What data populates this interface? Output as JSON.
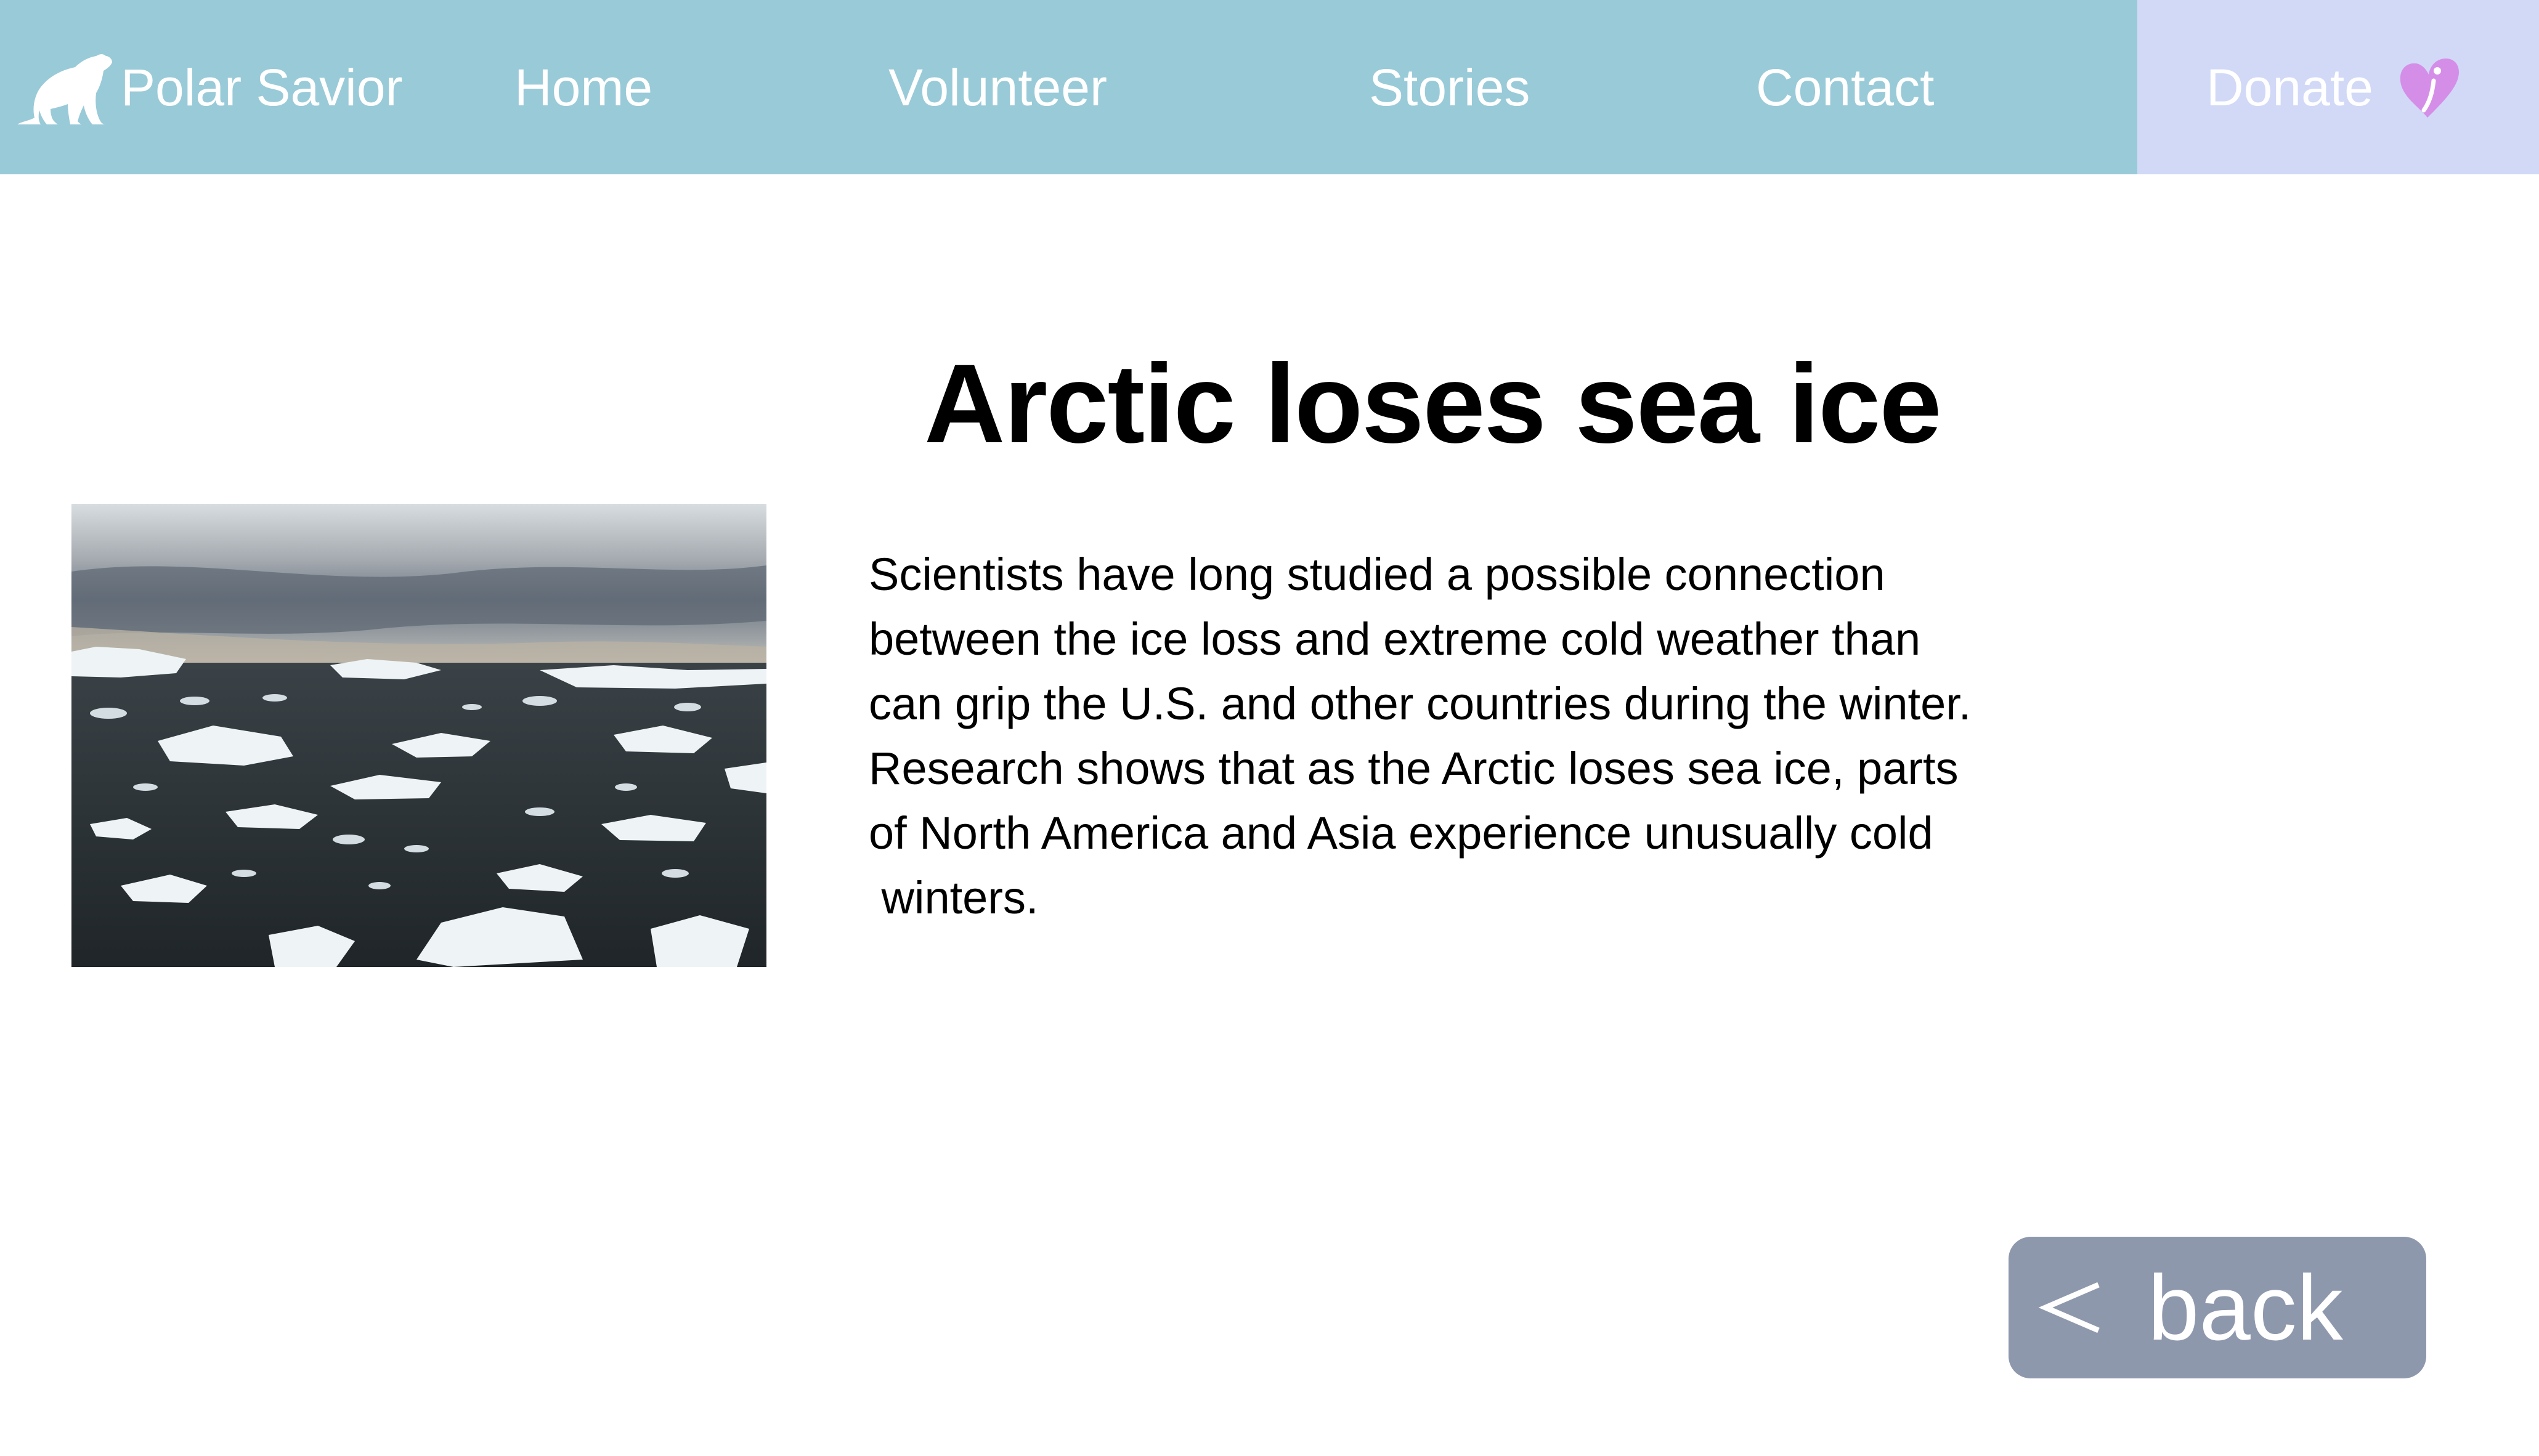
{
  "brand": {
    "name": "Polar Savior",
    "logo_icon": "polar-bear-icon"
  },
  "nav": {
    "items": [
      {
        "label": "Home"
      },
      {
        "label": "Volunteer"
      },
      {
        "label": "Stories"
      },
      {
        "label": "Contact"
      }
    ],
    "donate": {
      "label": "Donate",
      "icon": "heart-icon"
    }
  },
  "article": {
    "title": "Arctic loses sea ice",
    "image_subject": "sea-ice-photo",
    "body_lines": [
      "Scientists have long studied a possible connection",
      "between the ice loss and extreme cold weather than",
      "can grip the U.S. and other countries during the winter.",
      "Research shows that as the Arctic loses sea ice, parts",
      "of North America and Asia experience unusually cold",
      " winters."
    ]
  },
  "back_button": {
    "label": "back",
    "icon": "chevron-left-icon"
  },
  "colors": {
    "navbar_bg": "#99cad8",
    "donate_bg": "#d1d9f7",
    "heart": "#d58ee8",
    "back_button_bg": "#8e98ad",
    "nav_text": "#ffffff",
    "body_text": "#000000"
  }
}
